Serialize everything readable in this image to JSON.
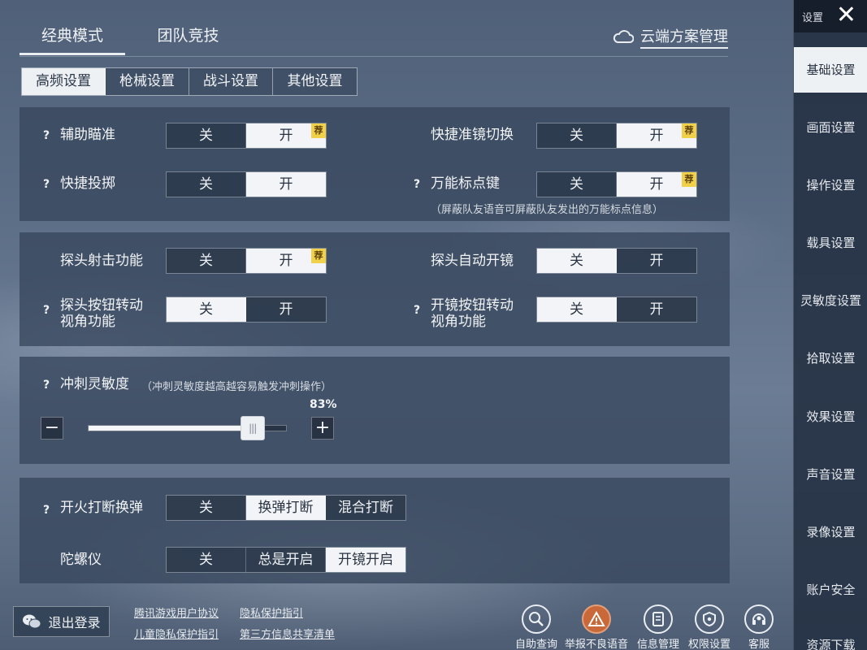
{
  "mode_tabs": [
    {
      "label": "经典模式",
      "active": true
    },
    {
      "label": "团队竞技",
      "active": false
    }
  ],
  "cloud": {
    "label": "云端方案管理",
    "icon": "cloud-icon"
  },
  "sub_tabs": [
    {
      "label": "高频设置",
      "active": true
    },
    {
      "label": "枪械设置",
      "active": false
    },
    {
      "label": "战斗设置",
      "active": false
    },
    {
      "label": "其他设置",
      "active": false
    }
  ],
  "rec_badge": "荐",
  "q": "?",
  "aim_assist": {
    "label": "辅助瞄准",
    "opts": [
      "关",
      "开"
    ],
    "selected": 1
  },
  "quick_scope": {
    "label": "快捷准镜切换",
    "opts": [
      "关",
      "开"
    ],
    "selected": 1
  },
  "quick_throw": {
    "label": "快捷投掷",
    "opts": [
      "关",
      "开"
    ],
    "selected": 1
  },
  "universal_marker": {
    "label": "万能标点键",
    "opts": [
      "关",
      "开"
    ],
    "selected": 1,
    "note": "（屏蔽队友语音可屏蔽队友发出的万能标点信息）"
  },
  "peek_fire": {
    "label": "探头射击功能",
    "opts": [
      "关",
      "开"
    ],
    "selected": 1
  },
  "peek_auto_scope": {
    "label": "探头自动开镜",
    "opts": [
      "关",
      "开"
    ],
    "selected": 0
  },
  "peek_rotate": {
    "label_line1": "探头按钮转动",
    "label_line2": "视角功能",
    "opts": [
      "关",
      "开"
    ],
    "selected": 0
  },
  "scope_rotate": {
    "label_line1": "开镜按钮转动",
    "label_line2": "视角功能",
    "opts": [
      "关",
      "开"
    ],
    "selected": 0
  },
  "sprint": {
    "label": "冲刺灵敏度",
    "note": "（冲刺灵敏度越高越容易触发冲刺操作）",
    "value_text": "83%",
    "value": 0.83,
    "minus": "−",
    "plus": "+",
    "thumb_glyph": "|||"
  },
  "fire_interrupt": {
    "label": "开火打断换弹",
    "opts": [
      "关",
      "换弹打断",
      "混合打断"
    ],
    "selected": 1
  },
  "gyro": {
    "label": "陀螺仪",
    "opts": [
      "关",
      "总是开启",
      "开镜开启"
    ],
    "selected": 2
  },
  "sidebar": {
    "header": "设置",
    "close": "✕",
    "items": [
      {
        "label": "基础设置",
        "active": true
      },
      {
        "label": "画面设置",
        "active": false
      },
      {
        "label": "操作设置",
        "active": false
      },
      {
        "label": "载具设置",
        "active": false
      },
      {
        "label": "灵敏度设置",
        "active": false
      },
      {
        "label": "拾取设置",
        "active": false
      },
      {
        "label": "效果设置",
        "active": false
      },
      {
        "label": "声音设置",
        "active": false
      },
      {
        "label": "录像设置",
        "active": false
      },
      {
        "label": "账户安全",
        "active": false
      },
      {
        "label": "资源下载",
        "active": false
      }
    ]
  },
  "bottom": {
    "logout": "退出登录",
    "links": [
      "腾讯游戏用户协议",
      "隐私保护指引",
      "儿童隐私保护指引",
      "第三方信息共享清单"
    ],
    "icons": [
      {
        "label": "自助查询",
        "icon": "search-icon"
      },
      {
        "label": "举报不良语音",
        "icon": "warning-icon"
      },
      {
        "label": "信息管理",
        "icon": "document-icon"
      },
      {
        "label": "权限设置",
        "icon": "shield-icon"
      },
      {
        "label": "客服",
        "icon": "headset-icon"
      }
    ]
  }
}
